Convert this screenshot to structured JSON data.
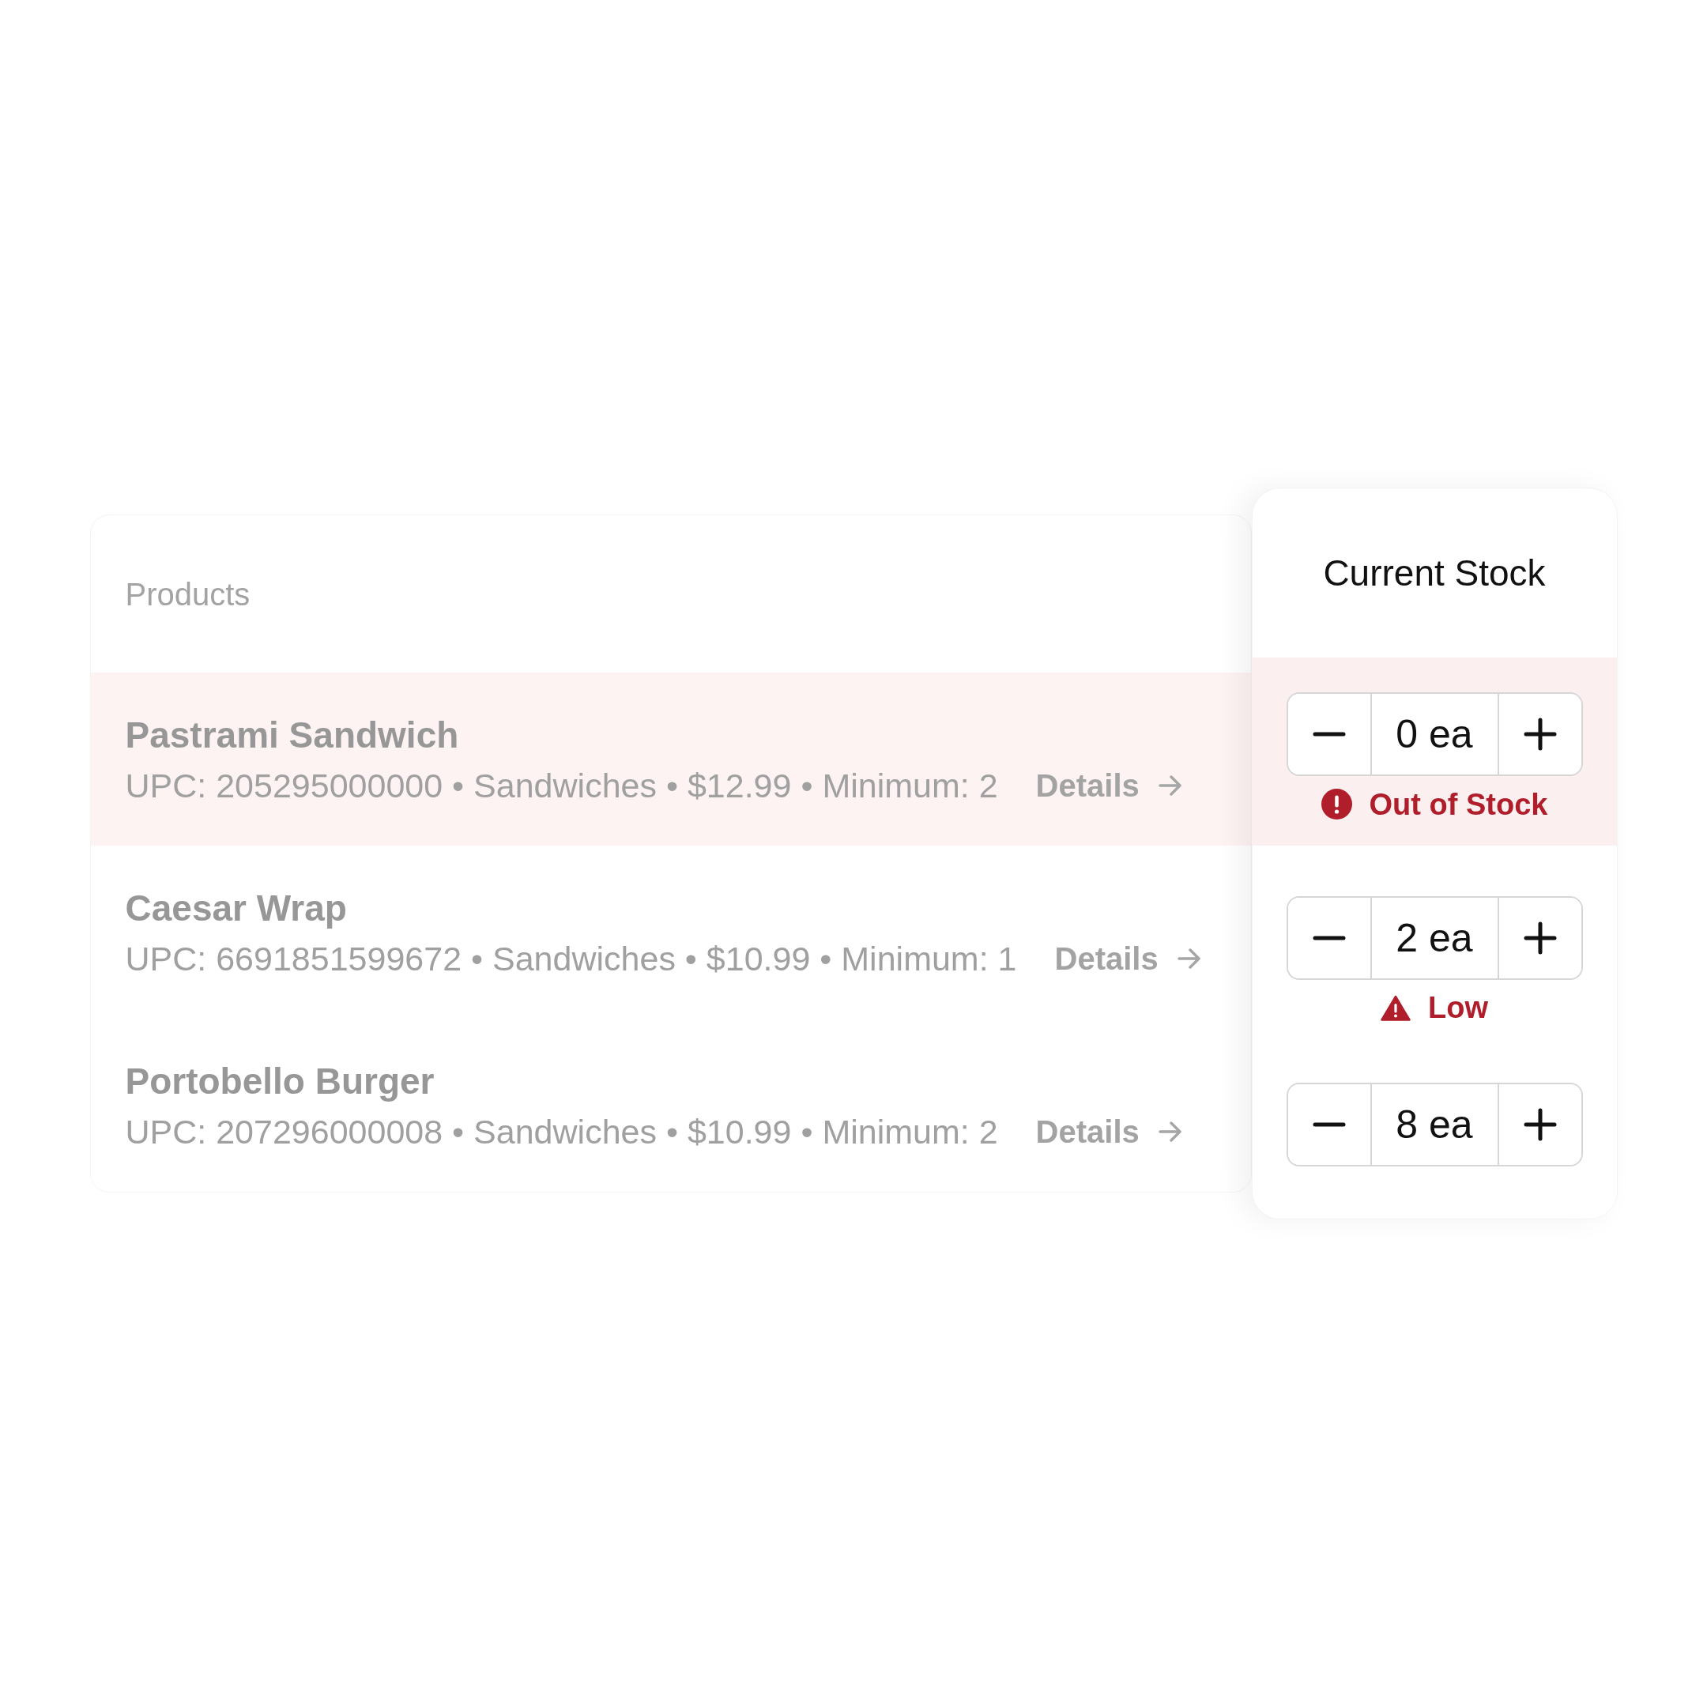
{
  "products": {
    "title": "Products",
    "rows": [
      {
        "name": "Pastrami Sandwich",
        "meta": "UPC: 205295000000 • Sandwiches • $12.99 • Minimum: 2",
        "link": "Details",
        "highlighted": true
      },
      {
        "name": "Caesar Wrap",
        "meta": "UPC: 6691851599672 • Sandwiches • $10.99 • Minimum: 1",
        "link": "Details",
        "highlighted": false
      },
      {
        "name": "Portobello Burger",
        "meta": "UPC: 207296000008 • Sandwiches • $10.99 • Minimum: 2",
        "link": "Details",
        "highlighted": false
      }
    ]
  },
  "stock": {
    "title": "Current Stock",
    "rows": [
      {
        "quantity": "0 ea",
        "highlighted": true,
        "status": {
          "kind": "error",
          "label": "Out of Stock"
        }
      },
      {
        "quantity": "2 ea",
        "highlighted": false,
        "status": {
          "kind": "warning",
          "label": "Low"
        }
      },
      {
        "quantity": "8 ea",
        "highlighted": false
      }
    ]
  }
}
